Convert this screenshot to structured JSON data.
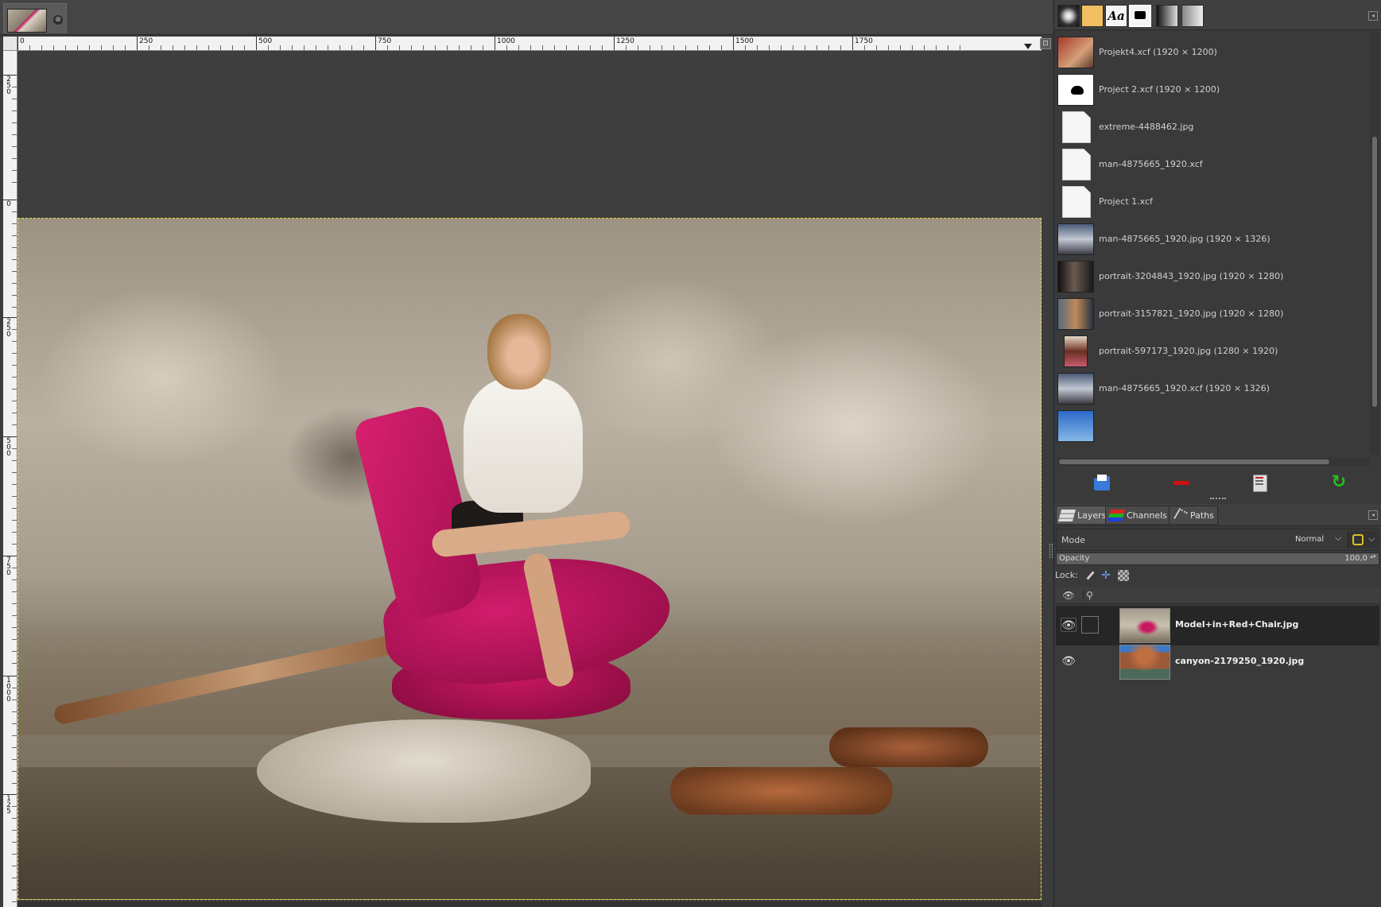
{
  "image_window": {
    "tab_close_glyph": "⊗",
    "ruler_h_labels": [
      "0",
      "250",
      "500",
      "750",
      "1000",
      "1250",
      "1500",
      "1750"
    ],
    "ruler_v_labels": [
      "250",
      "0",
      "250",
      "500",
      "750",
      "1000",
      "125"
    ],
    "nav_glyph": "⊡"
  },
  "dock": {
    "tabs": [
      {
        "icon": "brush-icon"
      },
      {
        "icon": "pattern-icon"
      },
      {
        "icon": "font-icon",
        "label": "Aa"
      },
      {
        "icon": "images-icon"
      },
      {
        "icon": "gradient-icon"
      },
      {
        "icon": "palette-icon"
      }
    ],
    "menu_glyph": "◂",
    "documents": [
      {
        "thumb": "photo1",
        "label": "Projekt4.xcf (1920 × 1200)"
      },
      {
        "thumb": "cloud",
        "label": "Project 2.xcf (1920 × 1200)"
      },
      {
        "thumb": "blank",
        "label": "extreme-4488462.jpg"
      },
      {
        "thumb": "blank",
        "label": "man-4875665_1920.xcf"
      },
      {
        "thumb": "blank",
        "label": "Project 1.xcf"
      },
      {
        "thumb": "man",
        "label": "man-4875665_1920.jpg (1920 × 1326)"
      },
      {
        "thumb": "bw",
        "label": "portrait-3204843_1920.jpg (1920 × 1280)"
      },
      {
        "thumb": "portrait2",
        "label": "portrait-3157821_1920.jpg (1920 × 1280)"
      },
      {
        "thumb": "portrait3",
        "label": "portrait-597173_1920.jpg (1280 × 1920)"
      },
      {
        "thumb": "man",
        "label": "man-4875665_1920.xcf (1920 × 1326)"
      }
    ],
    "actions": [
      "open-icon",
      "remove-icon",
      "print-icon",
      "refresh-icon"
    ],
    "refresh_glyph": "↻"
  },
  "layers_panel": {
    "tabs": {
      "layers": "Layers",
      "channels": "Channels",
      "paths": "Paths"
    },
    "mode_label": "Mode",
    "mode_value": "Normal",
    "chevron": "⌵",
    "opacity_label": "Opacity",
    "opacity_value": "100,0",
    "opacity_fraction": 1.0,
    "spin_glyph": "▴▾",
    "lock_label": "Lock:",
    "lock_position_glyph": "✛",
    "header_eye": "👁",
    "header_chain": "⚲",
    "layers": [
      {
        "name": "Model+in+Red+Chair.jpg",
        "thumb": "model",
        "visible": true,
        "selected": true
      },
      {
        "name": "canyon-2179250_1920.jpg",
        "thumb": "canyon",
        "visible": true,
        "selected": false
      }
    ],
    "eye_glyph": "👁"
  }
}
